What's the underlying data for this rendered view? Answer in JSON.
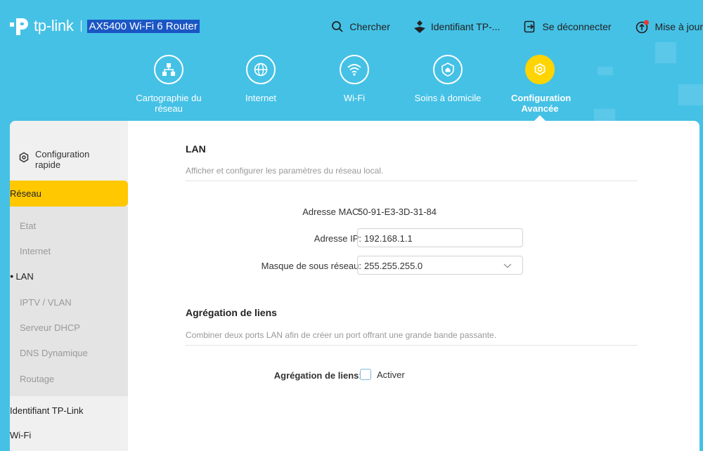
{
  "header": {
    "brand": "tp-link",
    "model": "AX5400 Wi-Fi 6 Router",
    "actions": [
      {
        "label": "Chercher",
        "icon": "search-icon"
      },
      {
        "label": "Identifiant TP-...",
        "icon": "tplink-id-icon"
      },
      {
        "label": "Se déconnecter",
        "icon": "logout-icon"
      },
      {
        "label": "Mise à jour",
        "icon": "update-icon"
      }
    ]
  },
  "nav": {
    "items": [
      {
        "label": "Cartographie du réseau",
        "icon": "network-map-icon"
      },
      {
        "label": "Internet",
        "icon": "globe-icon"
      },
      {
        "label": "Wi-Fi",
        "icon": "wifi-icon"
      },
      {
        "label": "Soins à domicile",
        "icon": "homecare-shield-icon"
      },
      {
        "label": "Configuration Avancée",
        "icon": "gear-icon",
        "active": true
      }
    ]
  },
  "sidebar": {
    "quick_setup": "Configuration rapide",
    "network": "Réseau",
    "sub_items": [
      "Etat",
      "Internet",
      "LAN",
      "IPTV / VLAN",
      "Serveur DHCP",
      "DNS Dynamique",
      "Routage"
    ],
    "active_sub": "LAN",
    "more": [
      "Identifiant TP-Link",
      "Wi-Fi"
    ]
  },
  "lan": {
    "title": "LAN",
    "description": "Afficher et configurer les paramètres du réseau local.",
    "mac_label": "Adresse MAC:",
    "mac_value": "50-91-E3-3D-31-84",
    "ip_label": "Adresse IP:",
    "ip_value": "192.168.1.1",
    "mask_label": "Masque de sous réseau:",
    "mask_value": "255.255.255.0"
  },
  "aggregation": {
    "title": "Agrégation de liens",
    "description": "Combiner deux ports LAN afin de créer un port offrant une grande bande passante.",
    "label": "Agrégation de liens",
    "colon": ":",
    "checkbox_label": "Activer",
    "checked": false
  },
  "colors": {
    "header_bg": "#45c1e6",
    "accent": "#ffc800",
    "model_highlight": "#1a56c4"
  }
}
